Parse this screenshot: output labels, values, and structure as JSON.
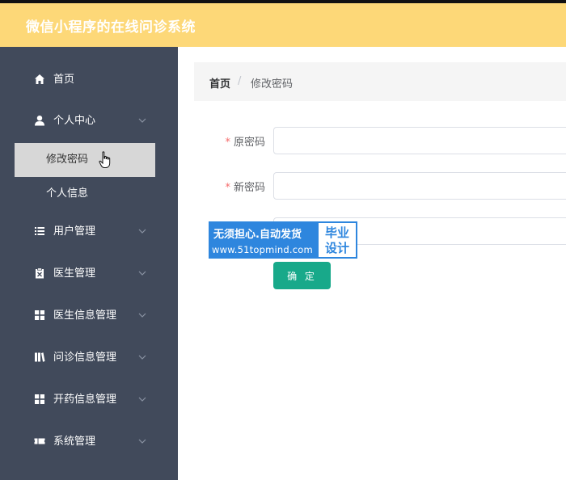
{
  "app": {
    "title": "微信小程序的在线问诊系统"
  },
  "colors": {
    "header": "#fdd878",
    "sidebar": "#414a5b",
    "primary": "#18a98a",
    "required": "#f56c6c"
  },
  "sidebar": {
    "items": [
      {
        "label": "首页",
        "icon": "home-icon"
      },
      {
        "label": "个人中心",
        "icon": "user-icon",
        "expanded": true,
        "children": [
          {
            "label": "修改密码",
            "active": true
          },
          {
            "label": "个人信息"
          }
        ]
      },
      {
        "label": "用户管理",
        "icon": "list-icon"
      },
      {
        "label": "医生管理",
        "icon": "clipboard-icon"
      },
      {
        "label": "医生信息管理",
        "icon": "grid-icon"
      },
      {
        "label": "问诊信息管理",
        "icon": "book-icon"
      },
      {
        "label": "开药信息管理",
        "icon": "grid-icon"
      },
      {
        "label": "系统管理",
        "icon": "ticket-icon"
      }
    ]
  },
  "breadcrumb": {
    "home": "首页",
    "separator": "/",
    "current": "修改密码"
  },
  "form": {
    "required_mark": "*",
    "old_password": {
      "label": "原密码",
      "value": ""
    },
    "new_password": {
      "label": "新密码",
      "value": ""
    },
    "confirm_password": {
      "value": ""
    },
    "submit_label": "确 定"
  },
  "watermark": {
    "line1": "无须担心.自动发货",
    "line2": "www.51topmind.com",
    "badge_line1": "毕业",
    "badge_line2": "设计"
  }
}
